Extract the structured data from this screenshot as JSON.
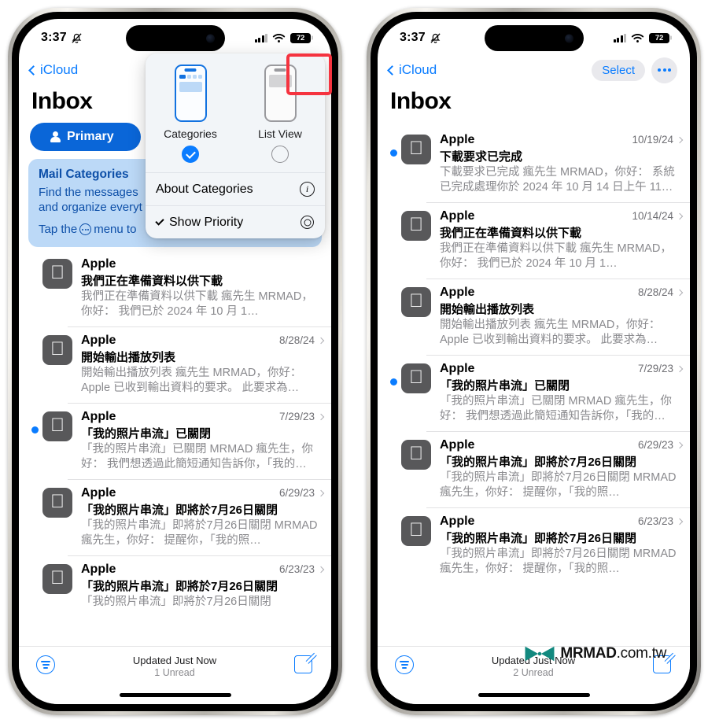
{
  "status_bar": {
    "time": "3:37",
    "silent_icon": "bell-slash-icon",
    "battery": "72",
    "signal": "cellular-bars-icon",
    "wifi": "wifi-icon"
  },
  "nav": {
    "back_label": "iCloud",
    "select_label": "Select",
    "more_label": "•••"
  },
  "page_title": "Inbox",
  "tabs": {
    "primary_label": "Primary"
  },
  "banner": {
    "title": "Mail Categories",
    "line1": "Find the messages",
    "line2": "and organize everyt",
    "line3_pre": "Tap the",
    "line3_post": "menu to"
  },
  "menu": {
    "categories_label": "Categories",
    "list_view_label": "List View",
    "categories_selected": true,
    "list_view_selected": false,
    "about_label": "About Categories",
    "about_icon": "info-circle-icon",
    "priority_label": "Show Priority",
    "priority_checked": true,
    "priority_icon": "gear-icon"
  },
  "toolbar_left": {
    "updated": "Updated Just Now",
    "unread": "1 Unread",
    "filter_icon": "filter-icon",
    "compose_icon": "compose-icon"
  },
  "toolbar_right": {
    "updated": "Updated Just Now",
    "unread": "2 Unread",
    "filter_icon": "filter-icon",
    "compose_icon": "compose-icon"
  },
  "watermark": {
    "brand": "MRMAD",
    "suffix": ".com.tw",
    "logo": "mrmad-bowtie-logo"
  },
  "left_phone": {
    "emails": [
      {
        "sender": "Apple",
        "date": "",
        "subject": "我們正在準備資料以供下載",
        "preview": "我們正在準備資料以供下載 瘋先生 MRMAD，你好： 我們已於 2024 年 10 月 1…",
        "unread": false
      },
      {
        "sender": "Apple",
        "date": "8/28/24",
        "subject": "開始輸出播放列表",
        "preview": "開始輸出播放列表 瘋先生 MRMAD，你好： Apple 已收到輸出資料的要求。 此要求為…",
        "unread": false
      },
      {
        "sender": "Apple",
        "date": "7/29/23",
        "subject": "「我的照片串流」已關閉",
        "preview": "「我的照片串流」已關閉 MRMAD 瘋先生，你好： 我們想透過此簡短通知告訴你，「我的…",
        "unread": true
      },
      {
        "sender": "Apple",
        "date": "6/29/23",
        "subject": "「我的照片串流」即將於7月26日關閉",
        "preview": "「我的照片串流」即將於7月26日關閉 MRMAD 瘋先生，你好： 提醒你，「我的照…",
        "unread": false
      },
      {
        "sender": "Apple",
        "date": "6/23/23",
        "subject": "「我的照片串流」即將於7月26日關閉",
        "preview": "「我的照片串流」即將於7月26日關閉",
        "unread": false
      }
    ]
  },
  "right_phone": {
    "emails": [
      {
        "sender": "Apple",
        "date": "10/19/24",
        "subject": "下載要求已完成",
        "preview": "下載要求已完成 瘋先生 MRMAD，你好： 系統已完成處理你於 2024 年 10 月 14 日上午 11…",
        "unread": true
      },
      {
        "sender": "Apple",
        "date": "10/14/24",
        "subject": "我們正在準備資料以供下載",
        "preview": "我們正在準備資料以供下載 瘋先生 MRMAD，你好： 我們已於 2024 年 10 月 1…",
        "unread": false
      },
      {
        "sender": "Apple",
        "date": "8/28/24",
        "subject": "開始輸出播放列表",
        "preview": "開始輸出播放列表 瘋先生 MRMAD，你好： Apple 已收到輸出資料的要求。 此要求為…",
        "unread": false
      },
      {
        "sender": "Apple",
        "date": "7/29/23",
        "subject": "「我的照片串流」已關閉",
        "preview": "「我的照片串流」已關閉 MRMAD 瘋先生，你好： 我們想透過此簡短通知告訴你，「我的…",
        "unread": true
      },
      {
        "sender": "Apple",
        "date": "6/29/23",
        "subject": "「我的照片串流」即將於7月26日關閉",
        "preview": "「我的照片串流」即將於7月26日關閉 MRMAD 瘋先生，你好： 提醒你，「我的照…",
        "unread": false
      },
      {
        "sender": "Apple",
        "date": "6/23/23",
        "subject": "「我的照片串流」即將於7月26日關閉",
        "preview": "「我的照片串流」即將於7月26日關閉 MRMAD 瘋先生，你好： 提醒你，「我的照…",
        "unread": false
      }
    ]
  },
  "colors": {
    "accent": "#0a7cff",
    "primary_tab": "#0a66d8",
    "banner_bg": "#bcd9f7",
    "highlight": "#f5333f",
    "watermark": "#12897f"
  }
}
